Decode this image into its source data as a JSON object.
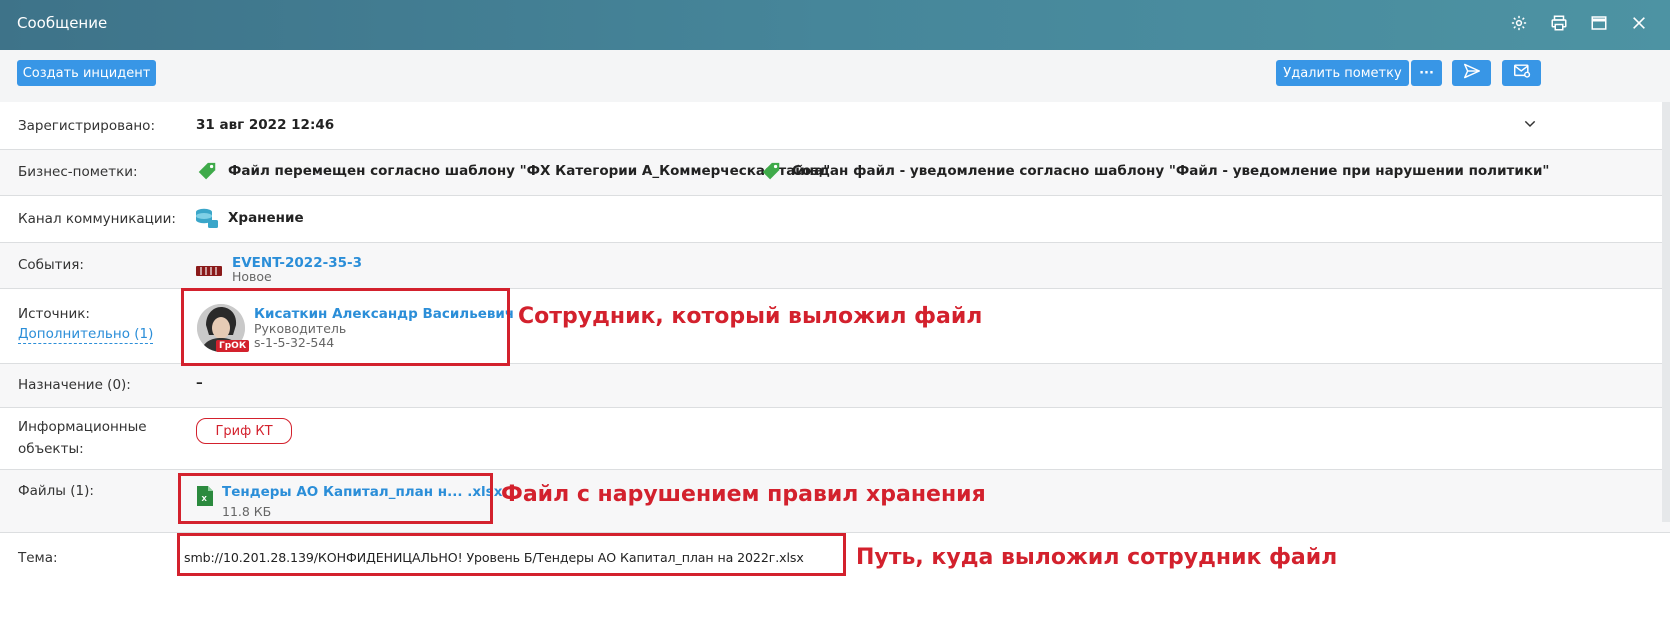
{
  "window": {
    "title": "Сообщение"
  },
  "toolbar": {
    "create_incident": "Создать инцидент",
    "remove_mark": "Удалить пометку",
    "more": "···"
  },
  "rows": {
    "registered": {
      "label": "Зарегистрировано:",
      "value": "31 авг 2022 12:46"
    },
    "business_marks": {
      "label": "Бизнес-пометки:",
      "items": [
        "Файл перемещен согласно шаблону \"ФХ Категории А_Коммерческая тайна\"",
        "Создан файл - уведомление согласно шаблону \"Файл - уведомление при нарушении политики\""
      ]
    },
    "channel": {
      "label": "Канал коммуникации:",
      "value": "Хранение"
    },
    "events": {
      "label": "События:",
      "id": "EVENT-2022-35-3",
      "status": "Новое"
    },
    "source": {
      "label": "Источник:",
      "more_link": "Дополнительно (1)",
      "person_name": "Кисаткин Александр Васильевич",
      "role": "Руководитель",
      "sid": "s-1-5-32-544",
      "badge": "ГрОК"
    },
    "destination": {
      "label": "Назначение (0):",
      "value": "–"
    },
    "info_objects": {
      "label": "Информационные объекты:",
      "tag": "Гриф КТ"
    },
    "files": {
      "label": "Файлы (1):",
      "name": "Тендеры АО Капитал_план н... .xlsx",
      "size": "11.8 КБ"
    },
    "subject": {
      "label": "Тема:",
      "value": "smb://10.201.28.139/КОНФИДЕНИЦАЛЬНО! Уровень Б/Тендеры АО Капитал_план на 2022г.xlsx"
    }
  },
  "annotations": {
    "source": "Сотрудник, который выложил файл",
    "files": "Файл с нарушением правил хранения",
    "subject": "Путь, куда выложил сотрудник файл"
  },
  "colors": {
    "accent": "#3896e6",
    "annotation_red": "#d3212d",
    "tag_green": "#3faa4a",
    "titlebar": "#46869a"
  }
}
